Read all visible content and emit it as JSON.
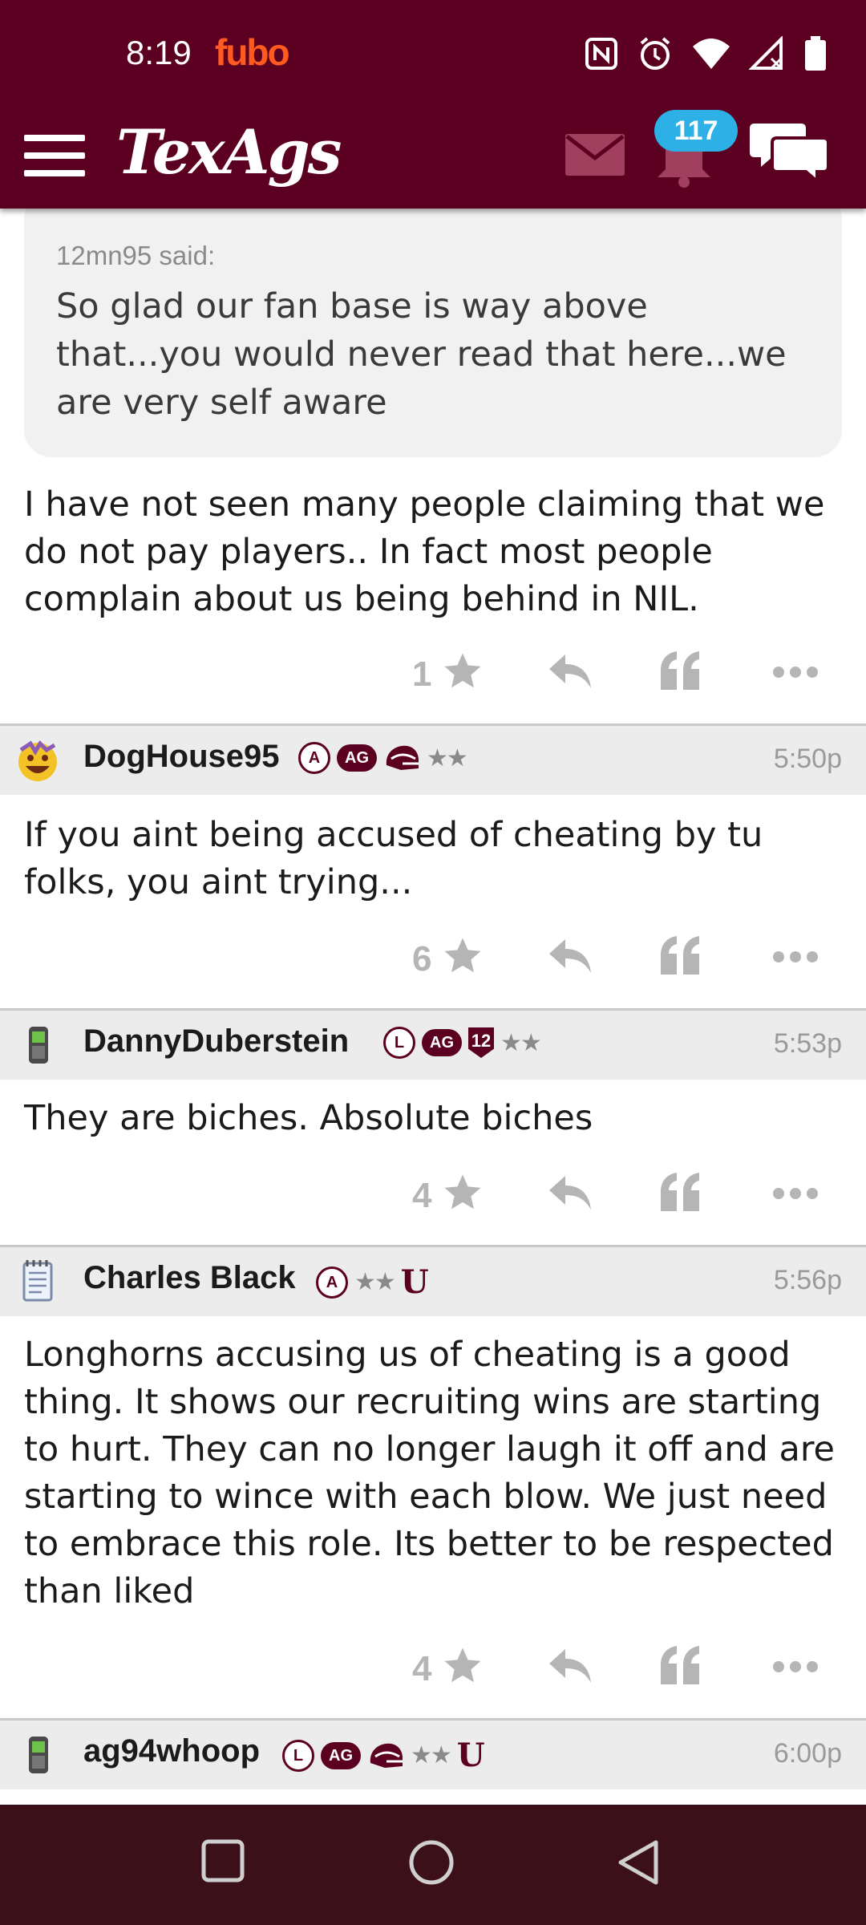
{
  "status_bar": {
    "time": "8:19",
    "app_label": "fubo",
    "icons": [
      "nfc-icon",
      "alarm-icon",
      "wifi-icon",
      "signal-icon",
      "battery-icon"
    ]
  },
  "app_bar": {
    "logo": "TexAgs",
    "notification_count": "117",
    "icons": [
      "menu-icon",
      "mail-icon",
      "bell-icon",
      "chat-icon"
    ],
    "color": "#5c0022"
  },
  "quote": {
    "author": "12mn95 said:",
    "text": "So glad our fan base is way above that...you would never read that here...we are very self aware"
  },
  "posts": [
    {
      "body": "I have not seen many people claiming that we do not pay players.. In fact most people complain about us being behind in NIL.",
      "likes": "1"
    },
    {
      "username": "DogHouse95",
      "time": "5:50p",
      "badge_a": "A",
      "badge_ag": "AG",
      "stars": "★★",
      "body": "If you aint being accused of cheating by tu folks, you aint trying...",
      "likes": "6"
    },
    {
      "username": "DannyDuberstein",
      "time": "5:53p",
      "badge_l": "L",
      "badge_ag": "AG",
      "badge_12": "12",
      "stars": "★★",
      "body": "They are biches. Absolute biches",
      "likes": "4"
    },
    {
      "username": "Charles Black",
      "time": "5:56p",
      "badge_a": "A",
      "stars": "★★",
      "badge_u": "U",
      "body": "Longhorns accusing us of cheating is a good thing. It shows our recruiting wins are starting to hurt. They can no longer laugh it off and are starting to wince with each blow. We just need to embrace this role. Its better to be respected than liked",
      "likes": "4"
    },
    {
      "username": "ag94whoop",
      "time": "6:00p",
      "badge_l": "L",
      "badge_ag": "AG",
      "stars": "★★",
      "badge_u": "U"
    }
  ],
  "nav_bar": {
    "icons": [
      "recents-icon",
      "home-icon",
      "back-icon"
    ]
  }
}
